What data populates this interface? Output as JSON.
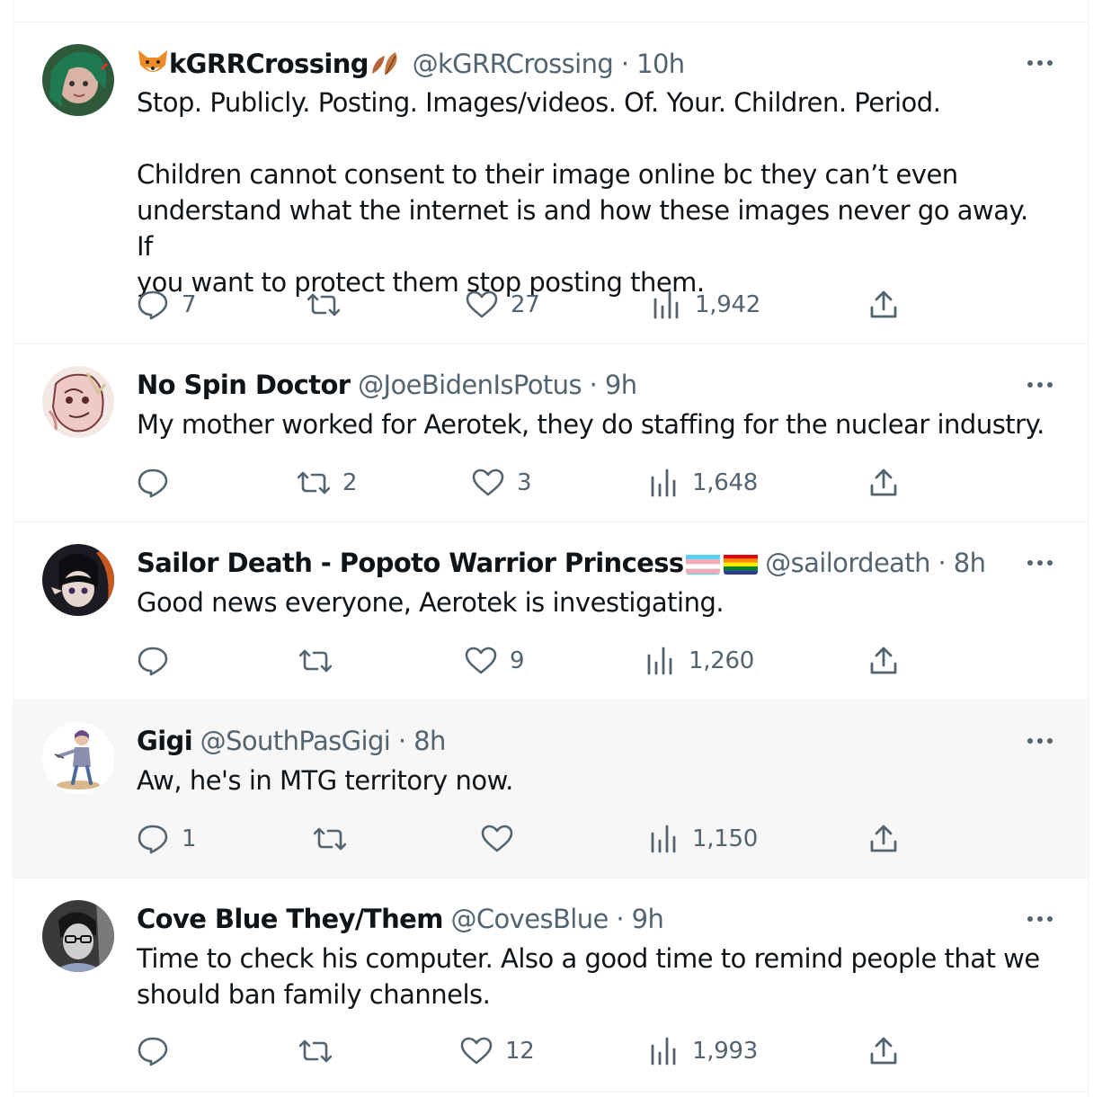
{
  "colors": {
    "text": "#0f1419",
    "muted": "#536471",
    "border": "#eff3f4",
    "highlight_bg": "#f7f7f7"
  },
  "tweets": [
    {
      "name": "kGRRCrossing",
      "handle": "@kGRRCrossing",
      "sep": "·",
      "time": "10h",
      "lines": [
        "Stop. Publicly. Posting. Images/videos. Of. Your. Children. Period.",
        "",
        "Children cannot consent to their image online bc they can’t even",
        "understand what the internet is and how these images never go away. If",
        "you want to protect them stop posting them."
      ],
      "replies": "7",
      "retweets": "",
      "likes": "27",
      "views": "1,942"
    },
    {
      "name": "No Spin Doctor",
      "handle": "@JoeBidenIsPotus",
      "sep": "·",
      "time": "9h",
      "lines": [
        "My mother worked for Aerotek, they do staffing for the nuclear industry."
      ],
      "replies": "",
      "retweets": "2",
      "likes": "3",
      "views": "1,648"
    },
    {
      "name": "Sailor Death - Popoto Warrior Princess",
      "handle": "@sailordeath",
      "sep": "·",
      "time": "8h",
      "lines": [
        "Good news everyone, Aerotek is investigating."
      ],
      "replies": "",
      "retweets": "",
      "likes": "9",
      "views": "1,260"
    },
    {
      "name": "Gigi",
      "handle": "@SouthPasGigi",
      "sep": "·",
      "time": "8h",
      "lines": [
        "Aw, he's in MTG territory now."
      ],
      "replies": "1",
      "retweets": "",
      "likes": "",
      "views": "1,150"
    },
    {
      "name": "Cove Blue They/Them",
      "handle": "@CovesBlue",
      "sep": "·",
      "time": "9h",
      "lines": [
        "Time to check his computer. Also a good time to remind people that we",
        "should ban family channels."
      ],
      "replies": "",
      "retweets": "",
      "likes": "12",
      "views": "1,993"
    }
  ]
}
